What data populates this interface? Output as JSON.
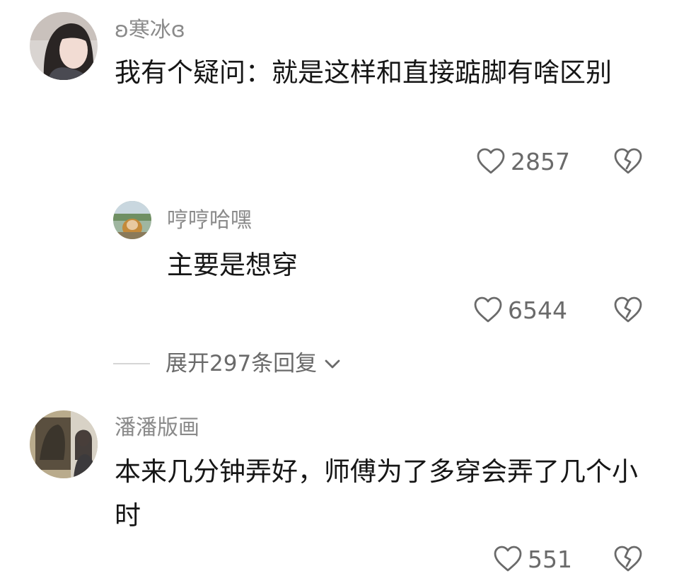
{
  "comments": [
    {
      "username": "ʚ寒冰ɞ",
      "text": "我有个疑问：就是这样和直接踮脚有啥区别",
      "likes": "2857",
      "avatar_icon": "avatar-photo-woman"
    },
    {
      "username": "哼哼哈嘿",
      "text": "主要是想穿",
      "likes": "6544",
      "avatar_icon": "avatar-photo-scenery"
    },
    {
      "username": "潘潘版画",
      "text": "本来几分钟弄好，师傅为了多穿会弄了几个小时",
      "likes": "551",
      "avatar_icon": "avatar-photo-artwork"
    }
  ],
  "expand_replies": {
    "label": "展开297条回复"
  },
  "icons": {
    "like": "heart-outline-icon",
    "dislike": "broken-heart-icon",
    "expand": "chevron-down-icon"
  },
  "colors": {
    "username": "#8a8a8a",
    "text": "#161616",
    "count": "#6a6a6a",
    "divider": "#d6d6d6"
  }
}
